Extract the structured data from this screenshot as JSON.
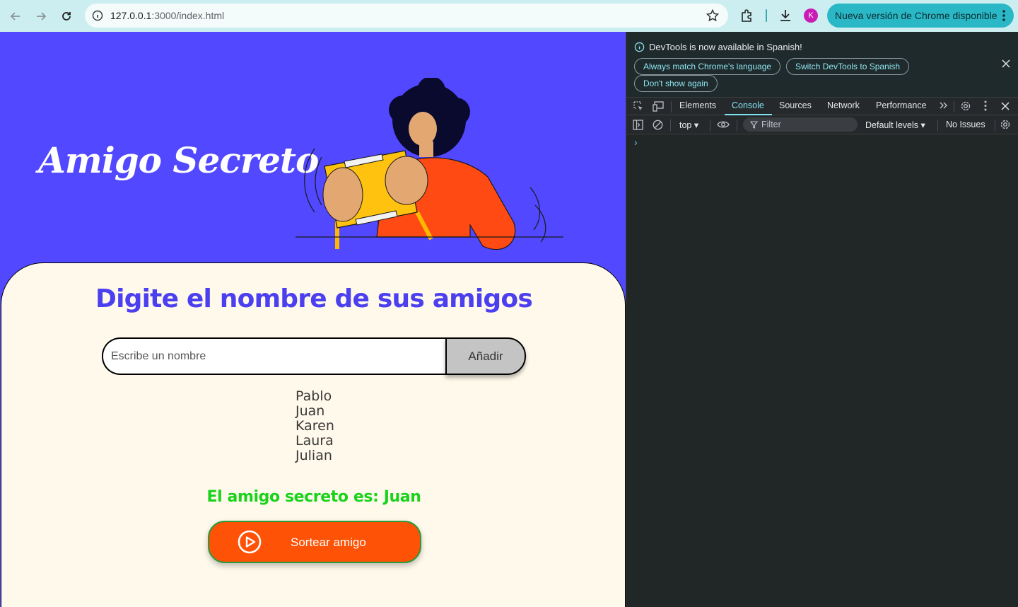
{
  "browser": {
    "url_host": "127.0.0.1",
    "url_rest": ":3000/index.html",
    "profile_initial": "K",
    "update_label": "Nueva versión de Chrome disponible",
    "colors": {
      "toolbar": "#cdeef0",
      "update_pill": "#2ab8c6",
      "avatar": "#c91bb5"
    }
  },
  "page": {
    "hero_title": "Amigo Secreto",
    "heading": "Digite el nombre de sus amigos",
    "input_placeholder": "Escribe un nombre",
    "input_value": "",
    "add_button": "Añadir",
    "friends": [
      "Pablo",
      "Juan",
      "Karen",
      "Laura",
      "Julian"
    ],
    "result": "El amigo secreto es: Juan",
    "draw_button": "Sortear amigo",
    "colors": {
      "background": "#5148ff",
      "card": "#fff9eb",
      "heading": "#4b3ff0",
      "result": "#19d31b",
      "draw_button": "#fe5206"
    }
  },
  "devtools": {
    "banner_message": "DevTools is now available in Spanish!",
    "banner_buttons": [
      "Always match Chrome's language",
      "Switch DevTools to Spanish",
      "Don't show again"
    ],
    "tabs": [
      "Elements",
      "Console",
      "Sources",
      "Network",
      "Performance"
    ],
    "active_tab": "Console",
    "context": "top",
    "filter_placeholder": "Filter",
    "levels": "Default levels",
    "issues": "No Issues",
    "prompt": "›"
  }
}
